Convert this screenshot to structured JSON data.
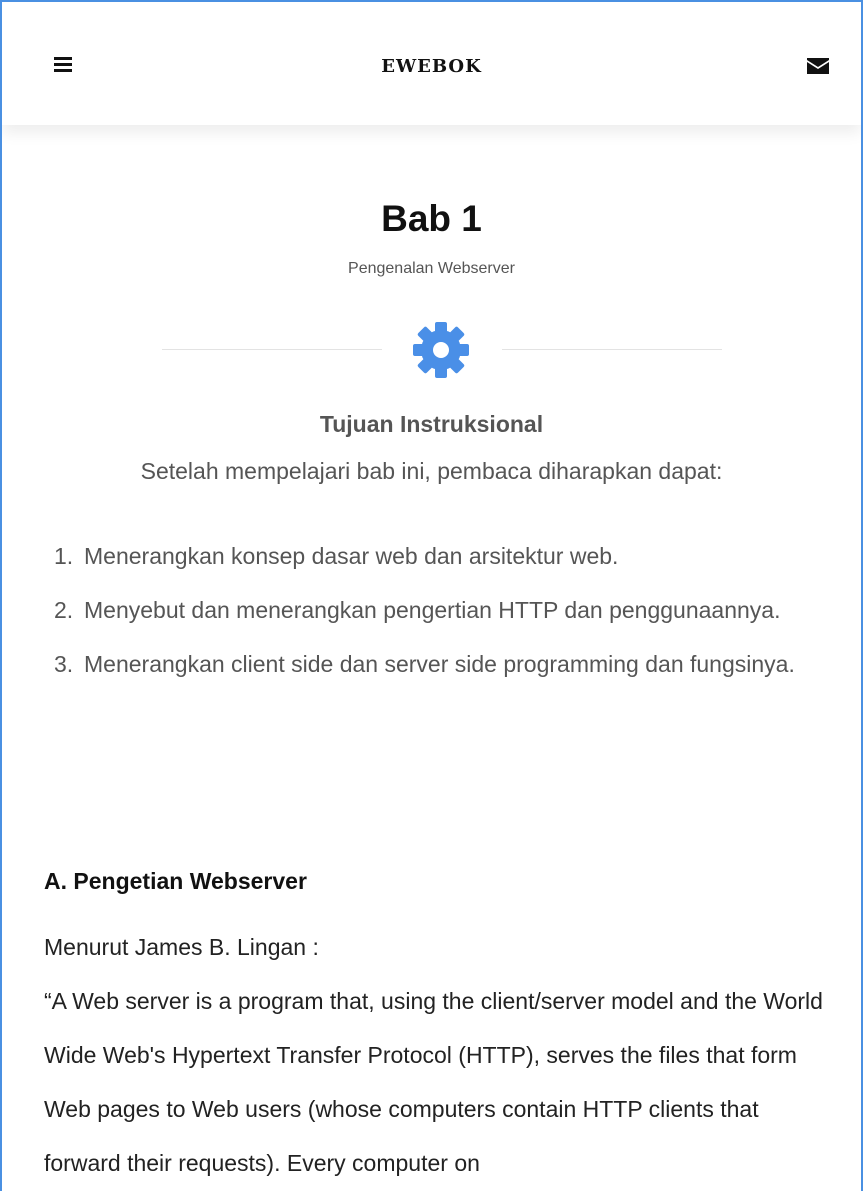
{
  "header": {
    "brand": "EWEBOK",
    "menu_icon": "hamburger-menu-icon",
    "mail_icon": "envelope-icon"
  },
  "chapter": {
    "title": "Bab 1",
    "subtitle": "Pengenalan Webserver",
    "icon": "gear-icon",
    "icon_color": "#4a8fe7"
  },
  "objectives": {
    "heading": "Tujuan Instruksional",
    "intro": "Setelah mempelajari bab ini, pembaca diharapkan dapat:",
    "items": [
      {
        "num": "1.",
        "text": "Menerangkan konsep dasar web dan arsitektur web."
      },
      {
        "num": "2.",
        "text": "Menyebut dan menerangkan pengertian HTTP dan penggunaannya."
      },
      {
        "num": "3.",
        "text": "Menerangkan client side dan server side programming dan fungsinya."
      }
    ]
  },
  "section": {
    "heading": "A. Pengetian Webserver",
    "source_line": "Menurut James B. Lingan :",
    "quote": "“A Web server is a program that, using the client/server model and the World Wide Web's Hypertext Transfer Protocol (HTTP), serves the files that form Web pages to Web users (whose computers contain HTTP clients that forward their requests). Every computer on"
  },
  "colors": {
    "frame_border": "#4a90e2",
    "accent": "#4a8fe7"
  }
}
